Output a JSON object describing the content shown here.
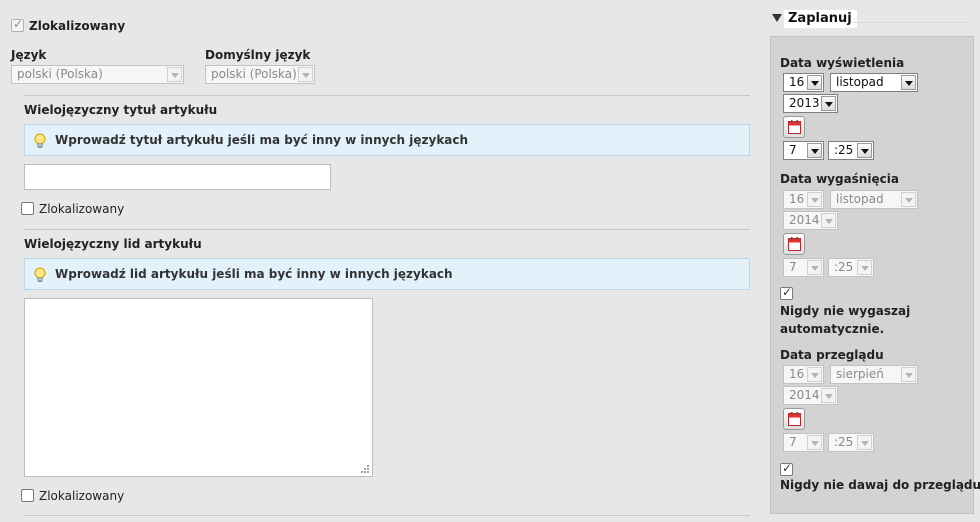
{
  "top": {
    "localized_label": "Zlokalizowany",
    "language_label": "Język",
    "language_value": "polski (Polska)",
    "default_language_label": "Domyślny język",
    "default_language_value": "polski (Polska)"
  },
  "title_section": {
    "heading": "Wielojęzyczny tytuł artykułu",
    "hint": "Wprowadź tytuł artykułu jeśli ma być inny w innych językach",
    "input_value": "",
    "localized_label": "Zlokalizowany"
  },
  "lead_section": {
    "heading": "Wielojęzyczny lid artykułu",
    "hint": "Wprowadź lid artykułu jeśli ma być inny w innych językach",
    "textarea_value": "",
    "localized_label": "Zlokalizowany"
  },
  "schedule": {
    "title": "Zaplanuj",
    "display": {
      "label": "Data wyświetlenia",
      "day": "16",
      "month": "listopad",
      "year": "2013",
      "hour": "7",
      "minute": ":25"
    },
    "expiry": {
      "label": "Data wygaśnięcia",
      "day": "16",
      "month": "listopad",
      "year": "2014",
      "hour": "7",
      "minute": ":25",
      "never_label": "Nigdy nie wygaszaj automatycznie."
    },
    "review": {
      "label": "Data przeglądu",
      "day": "16",
      "month": "sierpień",
      "year": "2014",
      "hour": "7",
      "minute": ":25",
      "never_label": "Nigdy nie dawaj do przeglądu"
    }
  },
  "colors": {
    "page_bg": "#e7e7e7",
    "panel_bg": "#d3d3d3",
    "hint_bg": "#e3f1fa",
    "hint_border": "#b6d6ec"
  }
}
